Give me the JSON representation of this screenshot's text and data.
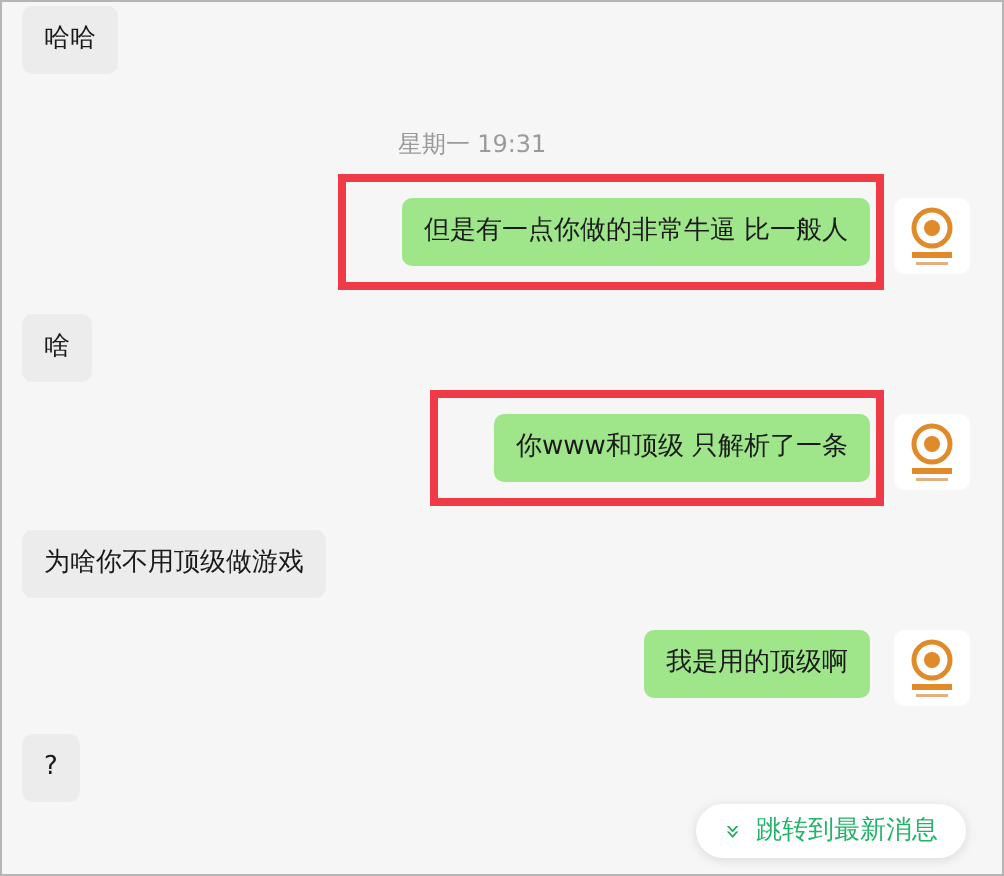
{
  "messages": [
    {
      "kind": "incoming",
      "text": "哈哈",
      "highlighted": false
    },
    {
      "kind": "time",
      "text": "星期一 19:31"
    },
    {
      "kind": "outgoing",
      "text": "但是有一点你做的非常牛逼 比一般人",
      "highlighted": true
    },
    {
      "kind": "incoming",
      "text": "啥",
      "highlighted": false
    },
    {
      "kind": "outgoing",
      "text": "你www和顶级 只解析了一条",
      "highlighted": true
    },
    {
      "kind": "incoming",
      "text": "为啥你不用顶级做游戏",
      "highlighted": false
    },
    {
      "kind": "outgoing",
      "text": "我是用的顶级啊",
      "highlighted": false
    },
    {
      "kind": "incoming",
      "text": "?",
      "highlighted": false
    }
  ],
  "jump_button": {
    "icon": "»",
    "label": "跳转到最新消息"
  }
}
